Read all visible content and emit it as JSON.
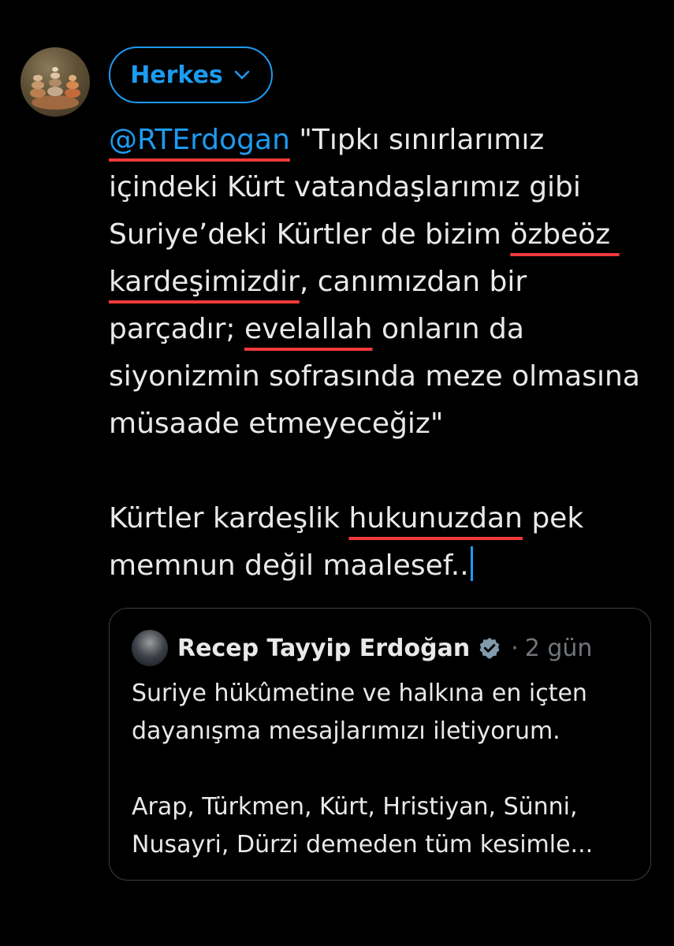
{
  "composer": {
    "audience_label": "Herkes",
    "mention": "@RTErdogan",
    "text_1": " \"Tıpkı sınırlarımız içindeki Kürt vatandaşlarımız gibi Suriye’deki Kürtler de bizim ",
    "underline_1": "özbeöz kardeşimizdir",
    "text_2": ", canımızdan bir parçadır; ",
    "underline_2": "evelallah",
    "text_3": " onların da siyonizmin sofrasında meze olmasına müsaade etmeyeceğiz\"\n\nKürtler kardeşlik ",
    "underline_3": "hukunuzdan",
    "text_4": " pek memnun değil maalesef.."
  },
  "quote": {
    "author_name": "Recep Tayyip Erdoğan",
    "separator": "·",
    "time": "2 gün",
    "text": "Suriye hükûmetine ve halkına en içten dayanışma mesajlarımızı iletiyorum.\n\nArap, Türkmen, Kürt, Hristiyan, Sünni, Nusayri, Dürzi demeden tüm kesimle..."
  },
  "colors": {
    "background": "#000000",
    "text": "#e7e9ea",
    "accent": "#1d9bf0",
    "muted": "#71767b",
    "annotation_underline": "#f23a3a"
  },
  "icons": [
    "chevron-down-icon",
    "verified-badge-icon"
  ]
}
